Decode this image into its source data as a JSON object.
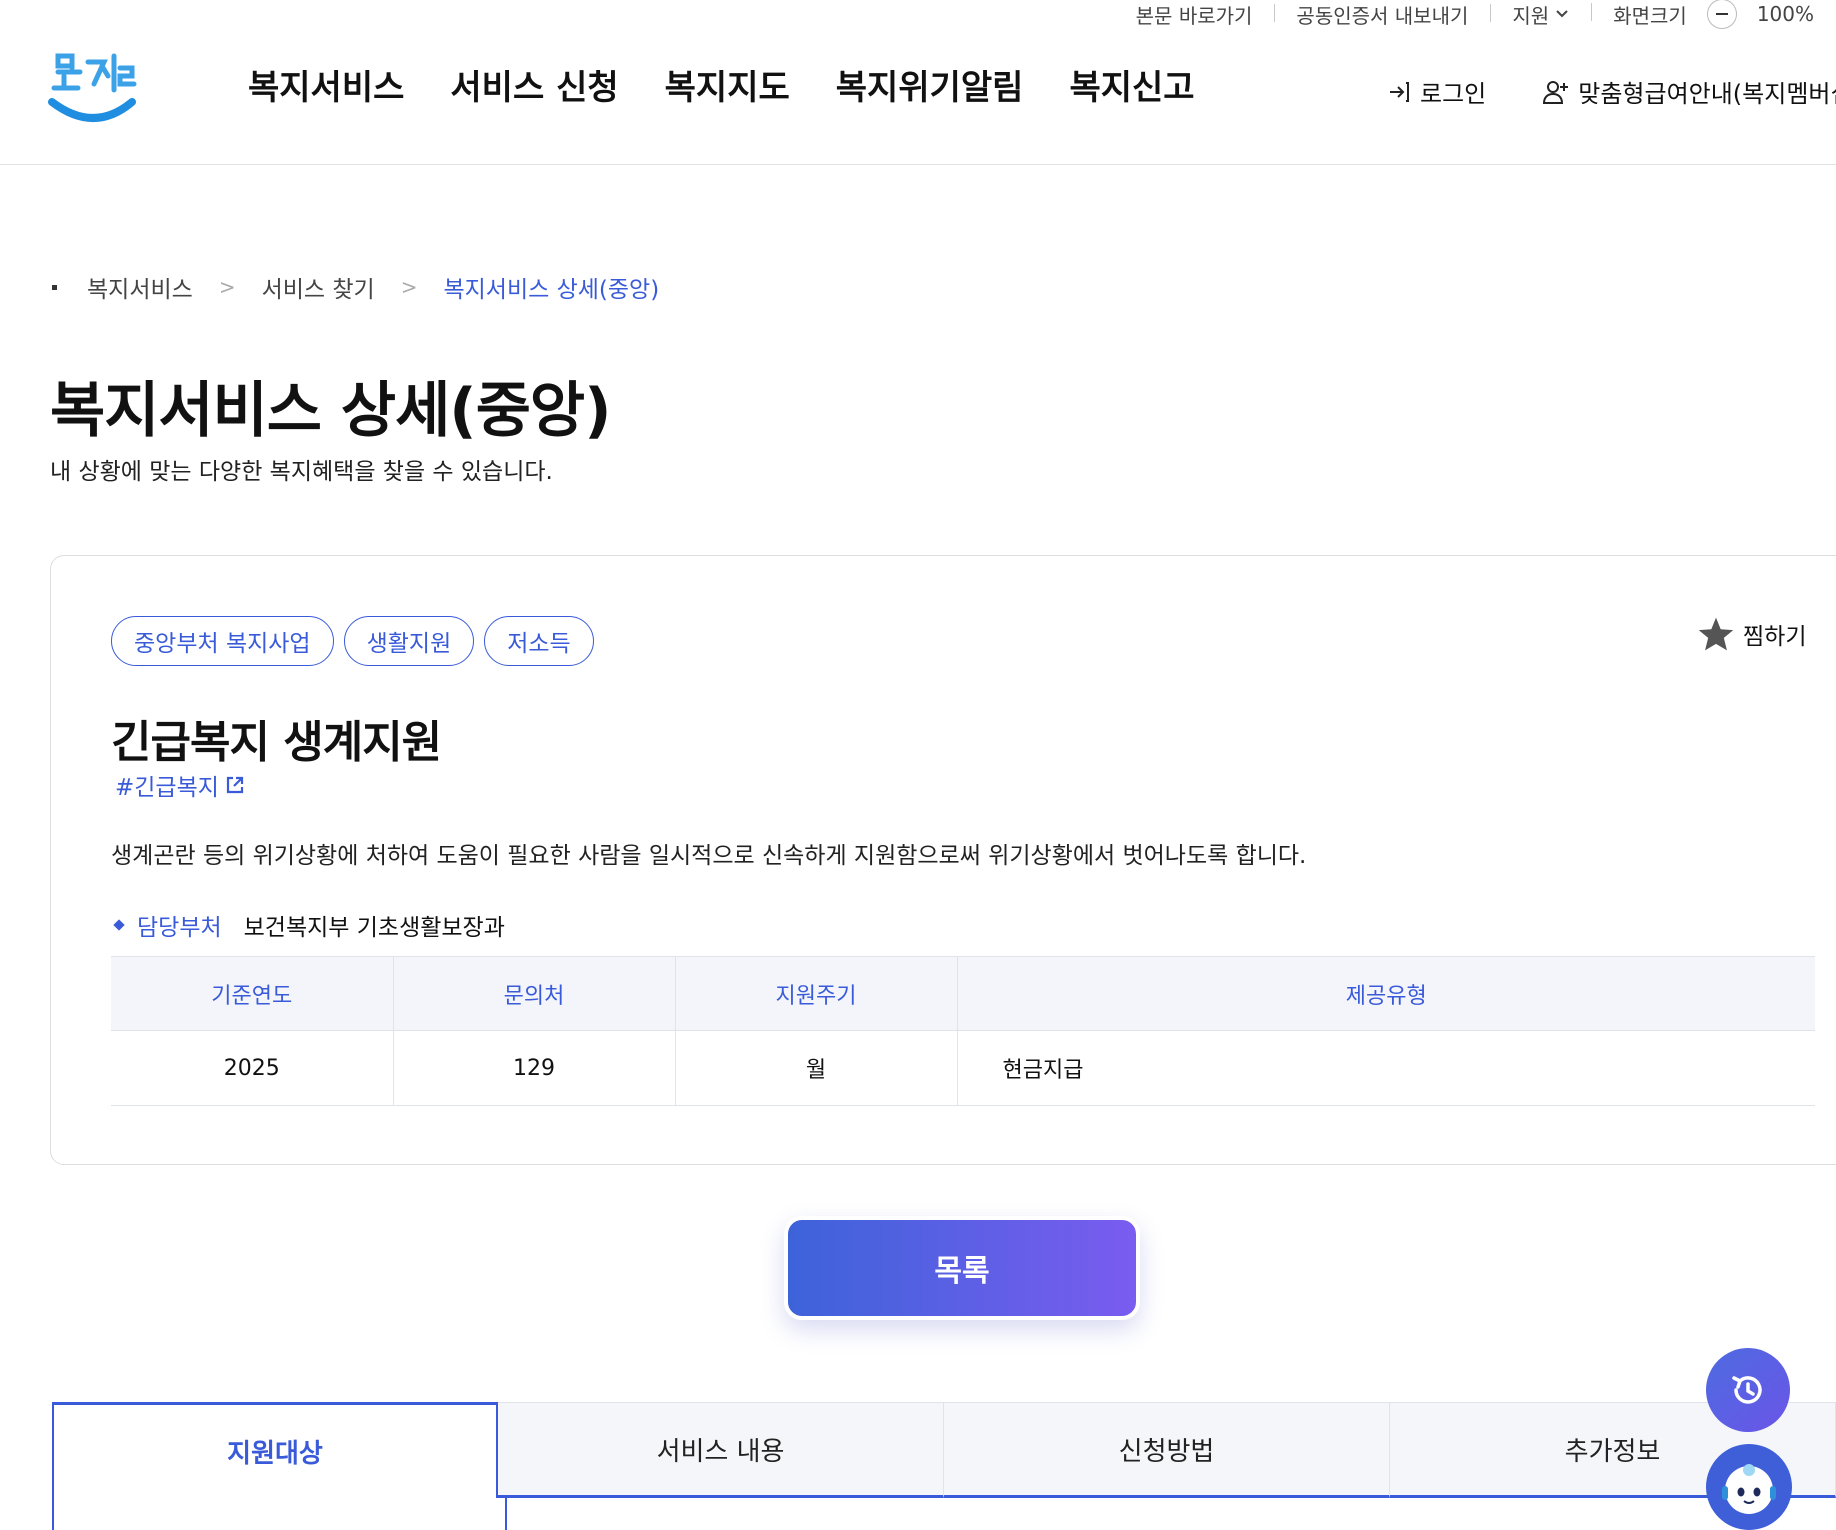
{
  "utility": {
    "skip_link": "본문 바로가기",
    "cert_export": "공동인증서 내보내기",
    "region": "지원",
    "screen_size": "화면크기",
    "zoom": "100%"
  },
  "header": {
    "logo_text": "복지로",
    "nav": [
      "복지서비스",
      "서비스 신청",
      "복지지도",
      "복지위기알림",
      "복지신고"
    ],
    "login": "로그인",
    "custom_benefit": "맞춤형급여안내(복지멤버십"
  },
  "breadcrumb": [
    "복지서비스",
    "서비스 찾기",
    "복지서비스 상세(중앙)"
  ],
  "page": {
    "title": "복지서비스 상세(중앙)",
    "description": "내 상황에 맞는 다양한 복지혜택을 찾을 수 있습니다."
  },
  "service": {
    "tags": [
      "중앙부처 복지사업",
      "생활지원",
      "저소득"
    ],
    "favorite_label": "찜하기",
    "title": "긴급복지 생계지원",
    "hashtag": "#긴급복지",
    "description": "생계곤란 등의 위기상황에 처하여 도움이 필요한 사람을 일시적으로 신속하게 지원함으로써 위기상황에서 벗어나도록 합니다.",
    "dept_label": "담당부처",
    "dept_value": "보건복지부 기초생활보장과",
    "table": {
      "headers": [
        "기준연도",
        "문의처",
        "지원주기",
        "제공유형"
      ],
      "row": [
        "2025",
        "129",
        "월",
        "현금지급"
      ]
    }
  },
  "list_button": "목록",
  "tabs": [
    "지원대상",
    "서비스 내용",
    "신청방법",
    "추가정보"
  ],
  "colors": {
    "accent": "#3a5bd9",
    "button_gradient_start": "#3d63d9",
    "button_gradient_end": "#7a5cf0"
  }
}
